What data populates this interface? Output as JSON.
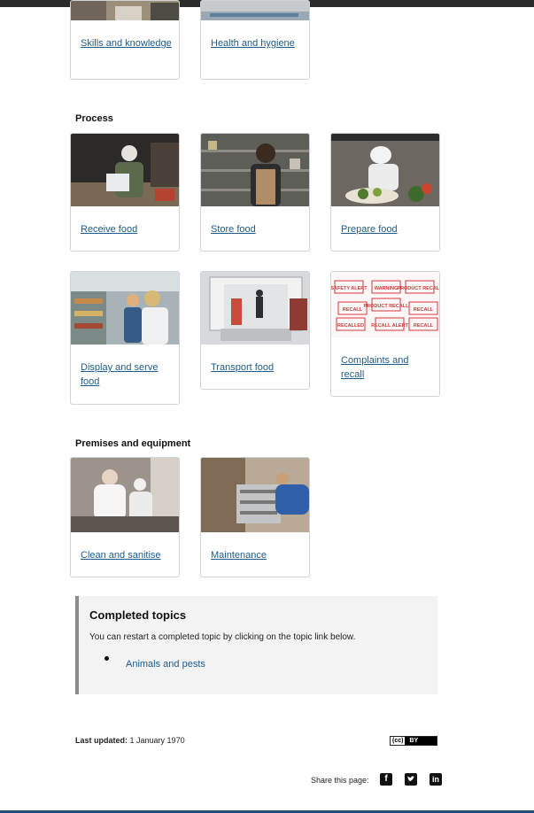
{
  "top_cards": [
    {
      "label": "Skills and knowledge",
      "image_alt": "kitchen staff"
    },
    {
      "label": "Health and hygiene",
      "image_alt": "hygiene"
    }
  ],
  "sections": {
    "process": {
      "heading": "Process",
      "cards": [
        {
          "label": "Receive food"
        },
        {
          "label": "Store food"
        },
        {
          "label": "Prepare food"
        },
        {
          "label": "Display and serve food"
        },
        {
          "label": "Transport food"
        },
        {
          "label": "Complaints and recall"
        }
      ]
    },
    "premises": {
      "heading": "Premises and equipment",
      "cards": [
        {
          "label": "Clean and sanitise"
        },
        {
          "label": "Maintenance"
        }
      ]
    }
  },
  "recall_stamps": [
    "SAFETY ALERT",
    "WARNING",
    "PRODUCT RECALL",
    "RECALL",
    "PRODUCT RECALL",
    "RECALL",
    "RECALLED",
    "RECALL ALERT",
    "RECALL"
  ],
  "completed": {
    "title": "Completed topics",
    "description": "You can restart a completed topic by clicking on the topic link below.",
    "items": [
      "Animals and pests"
    ]
  },
  "footer": {
    "last_updated_label": "Last updated:",
    "last_updated_value": "1 January 1970",
    "license_cc": "(cc)",
    "license_by": "BY",
    "share_label": "Share this page:"
  },
  "colors": {
    "link": "#1d5b8c",
    "panel": "#f3f3f3",
    "panel_border": "#8c8c8c",
    "recall_red": "#d23a3a"
  }
}
